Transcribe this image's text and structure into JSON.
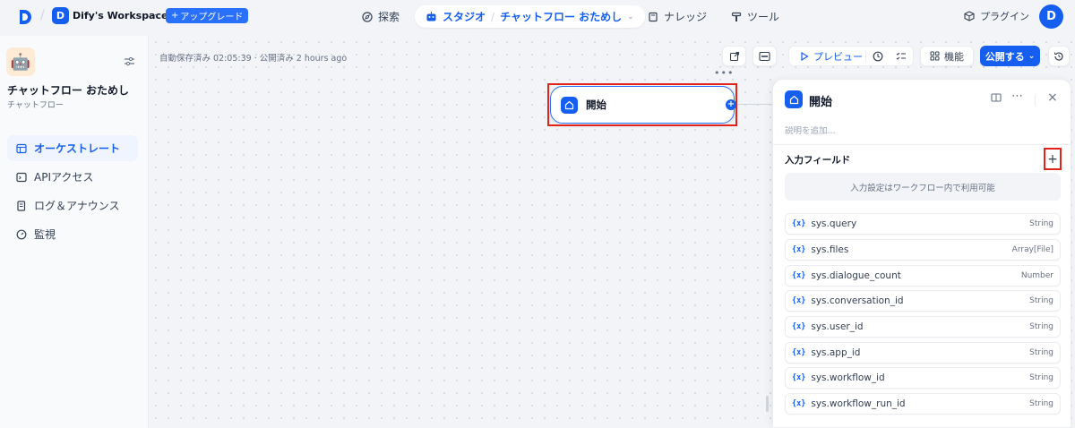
{
  "header": {
    "workspace_initial": "D",
    "workspace_name": "Dify's Workspace",
    "upgrade_label": "アップグレード",
    "nav_explore": "探索",
    "nav_studio": "スタジオ",
    "current_app": "チャットフロー おためし",
    "nav_knowledge": "ナレッジ",
    "nav_tools": "ツール",
    "plugins": "プラグイン",
    "user_initial": "D"
  },
  "sidebar": {
    "app_title": "チャットフロー おためし",
    "app_type": "チャットフロー",
    "items": [
      {
        "label": "オーケストレート",
        "active": true
      },
      {
        "label": "APIアクセス",
        "active": false
      },
      {
        "label": "ログ＆アナウンス",
        "active": false
      },
      {
        "label": "監視",
        "active": false
      }
    ]
  },
  "canvas": {
    "autosave": "自動保存済み 02:05:39 · 公開済み 2 hours ago",
    "preview_label": "プレビュー",
    "features_label": "機能",
    "publish_label": "公開する",
    "node_title": "開始"
  },
  "panel": {
    "title": "開始",
    "description_placeholder": "説明を追加...",
    "section_title": "入力フィールド",
    "hint": "入力設定はワークフロー内で利用可能",
    "variables": [
      {
        "name": "sys.query",
        "type": "String"
      },
      {
        "name": "sys.files",
        "type": "Array[File]"
      },
      {
        "name": "sys.dialogue_count",
        "type": "Number"
      },
      {
        "name": "sys.conversation_id",
        "type": "String"
      },
      {
        "name": "sys.user_id",
        "type": "String"
      },
      {
        "name": "sys.app_id",
        "type": "String"
      },
      {
        "name": "sys.workflow_id",
        "type": "String"
      },
      {
        "name": "sys.workflow_run_id",
        "type": "String"
      }
    ]
  },
  "colors": {
    "accent": "#155eef",
    "highlight": "#e2231a"
  }
}
